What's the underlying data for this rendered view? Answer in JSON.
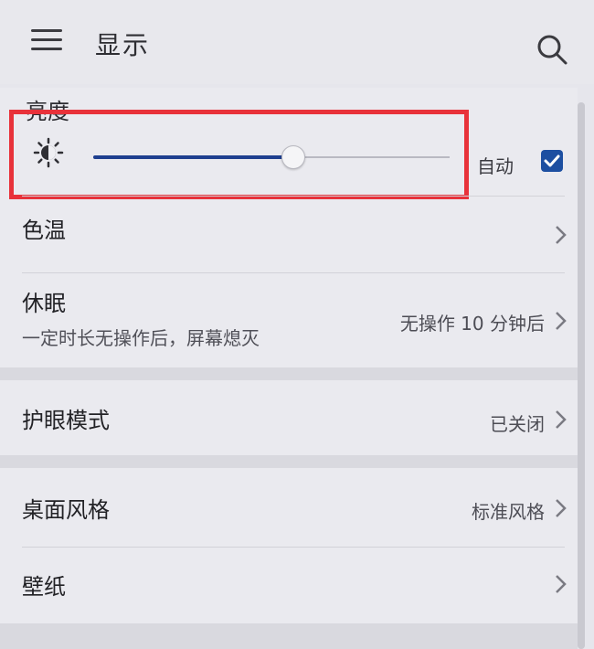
{
  "header": {
    "title": "显示",
    "menu_icon": "hamburger-menu-icon",
    "search_icon": "search-icon"
  },
  "brightness": {
    "label": "亮度",
    "icon": "brightness-sun-icon",
    "level": 0.56,
    "auto_label": "自动",
    "auto_checked": true,
    "accent": "#1e3f8f",
    "highlight_color": "#e8323a"
  },
  "rows": {
    "color_temp": {
      "title": "色温"
    },
    "sleep": {
      "title": "休眠",
      "subtitle": "一定时长无操作后，屏幕熄灭",
      "value": "无操作 10 分钟后"
    },
    "eye_comfort": {
      "title": "护眼模式",
      "value": "已关闭"
    },
    "desktop_style": {
      "title": "桌面风格",
      "value": "标准风格"
    },
    "wallpaper": {
      "title": "壁纸"
    }
  }
}
